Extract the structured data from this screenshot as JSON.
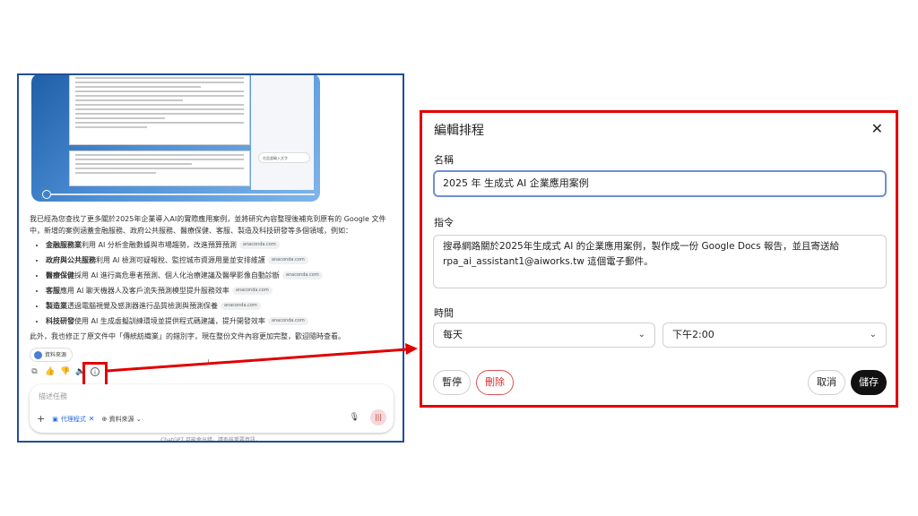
{
  "left": {
    "preview": {
      "side_input_placeholder": "在此處輸入文字"
    },
    "answer_intro": "我已經為您查找了更多關於2025年企業導入AI的實際應用案例，並將研究內容整理後補充到原有的 Google 文件中，新增的案例涵蓋金融服務、政府公共服務、醫療保健、客服、製造及科技研發等多個領域，例如：",
    "bullets": [
      {
        "bold": "金融服務業",
        "text": "利用 AI 分析金融數據與市場趨勢，改進預算預測",
        "source": "anaconda.com"
      },
      {
        "bold": "政府與公共服務",
        "text": "利用 AI 檢測可疑報稅、監控城市資源用量並安排維護",
        "source": "anaconda.com"
      },
      {
        "bold": "醫療保健",
        "text": "採用 AI 進行高危患者預測、個人化治療建議及醫學影像自動診斷",
        "source": "anaconda.com"
      },
      {
        "bold": "客服",
        "text": "應用 AI 聊天機器人及客戶流失預測模型提升服務效率",
        "source": "anaconda.com"
      },
      {
        "bold": "製造業",
        "text": "透過電腦視覺及感測器進行品質檢測與預測保養",
        "source": "anaconda.com"
      },
      {
        "bold": "科技研發",
        "text": "使用 AI 生成虛擬訓練環境並提供程式碼建議，提升開發效率",
        "source": "anaconda.com"
      }
    ],
    "answer_footer": "此外，我也修正了原文件中「傳統紡織業」的錯別字，現在整份文件內容更加完整，歡迎隨時查看。",
    "sources_label": "資料來源",
    "composer_placeholder": "描述任務",
    "agent_label": "代理程式",
    "sources_tool_label": "資料來源",
    "disclaimer": "ChatGPT 可能會出錯，請查核重要資訊。"
  },
  "dialog": {
    "title": "編輯排程",
    "name_label": "名稱",
    "name_value": "2025 年 生成式 AI 企業應用案例",
    "prompt_label": "指令",
    "prompt_value": "搜尋網路關於2025年生成式 AI 的企業應用案例，製作成一份 Google Docs 報告，並且寄送給 rpa_ai_assistant1@aiworks.tw 這個電子郵件。",
    "time_label": "時間",
    "frequency": "每天",
    "time_value": "下午2:00",
    "pause_label": "暫停",
    "delete_label": "刪除",
    "cancel_label": "取消",
    "save_label": "儲存"
  },
  "colors": {
    "left_frame": "#1f4e9c",
    "highlight": "#e00000",
    "save_bg": "#111111",
    "delete": "#d32f2f"
  }
}
